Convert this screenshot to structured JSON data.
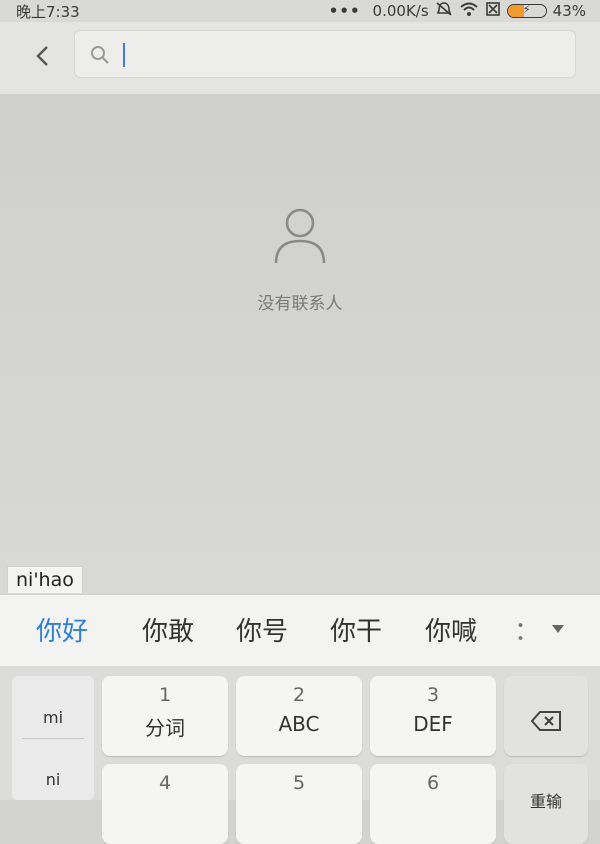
{
  "status_bar": {
    "time": "晚上7:33",
    "dots": "•••",
    "network_speed": "0.00K/s",
    "battery_percent": "43%",
    "battery_level": 0.43,
    "battery_color": "#f29a2e"
  },
  "search": {
    "placeholder": "",
    "value": ""
  },
  "empty_state": {
    "message": "没有联系人"
  },
  "ime": {
    "composing_text": "ni'hao",
    "candidates": [
      "你好",
      "你敢",
      "你号",
      "你干",
      "你喊"
    ],
    "candidate_more": "：",
    "selected_index": 0,
    "selected_color": "#2f7fd4",
    "side_panel": [
      "mi",
      "ni"
    ],
    "keys_row1": [
      {
        "num": "1",
        "label": "分词"
      },
      {
        "num": "2",
        "label": "ABC"
      },
      {
        "num": "3",
        "label": "DEF"
      }
    ],
    "keys_row2": [
      {
        "num": "4"
      },
      {
        "num": "5"
      },
      {
        "num": "6"
      }
    ],
    "reenter_label": "重输"
  }
}
